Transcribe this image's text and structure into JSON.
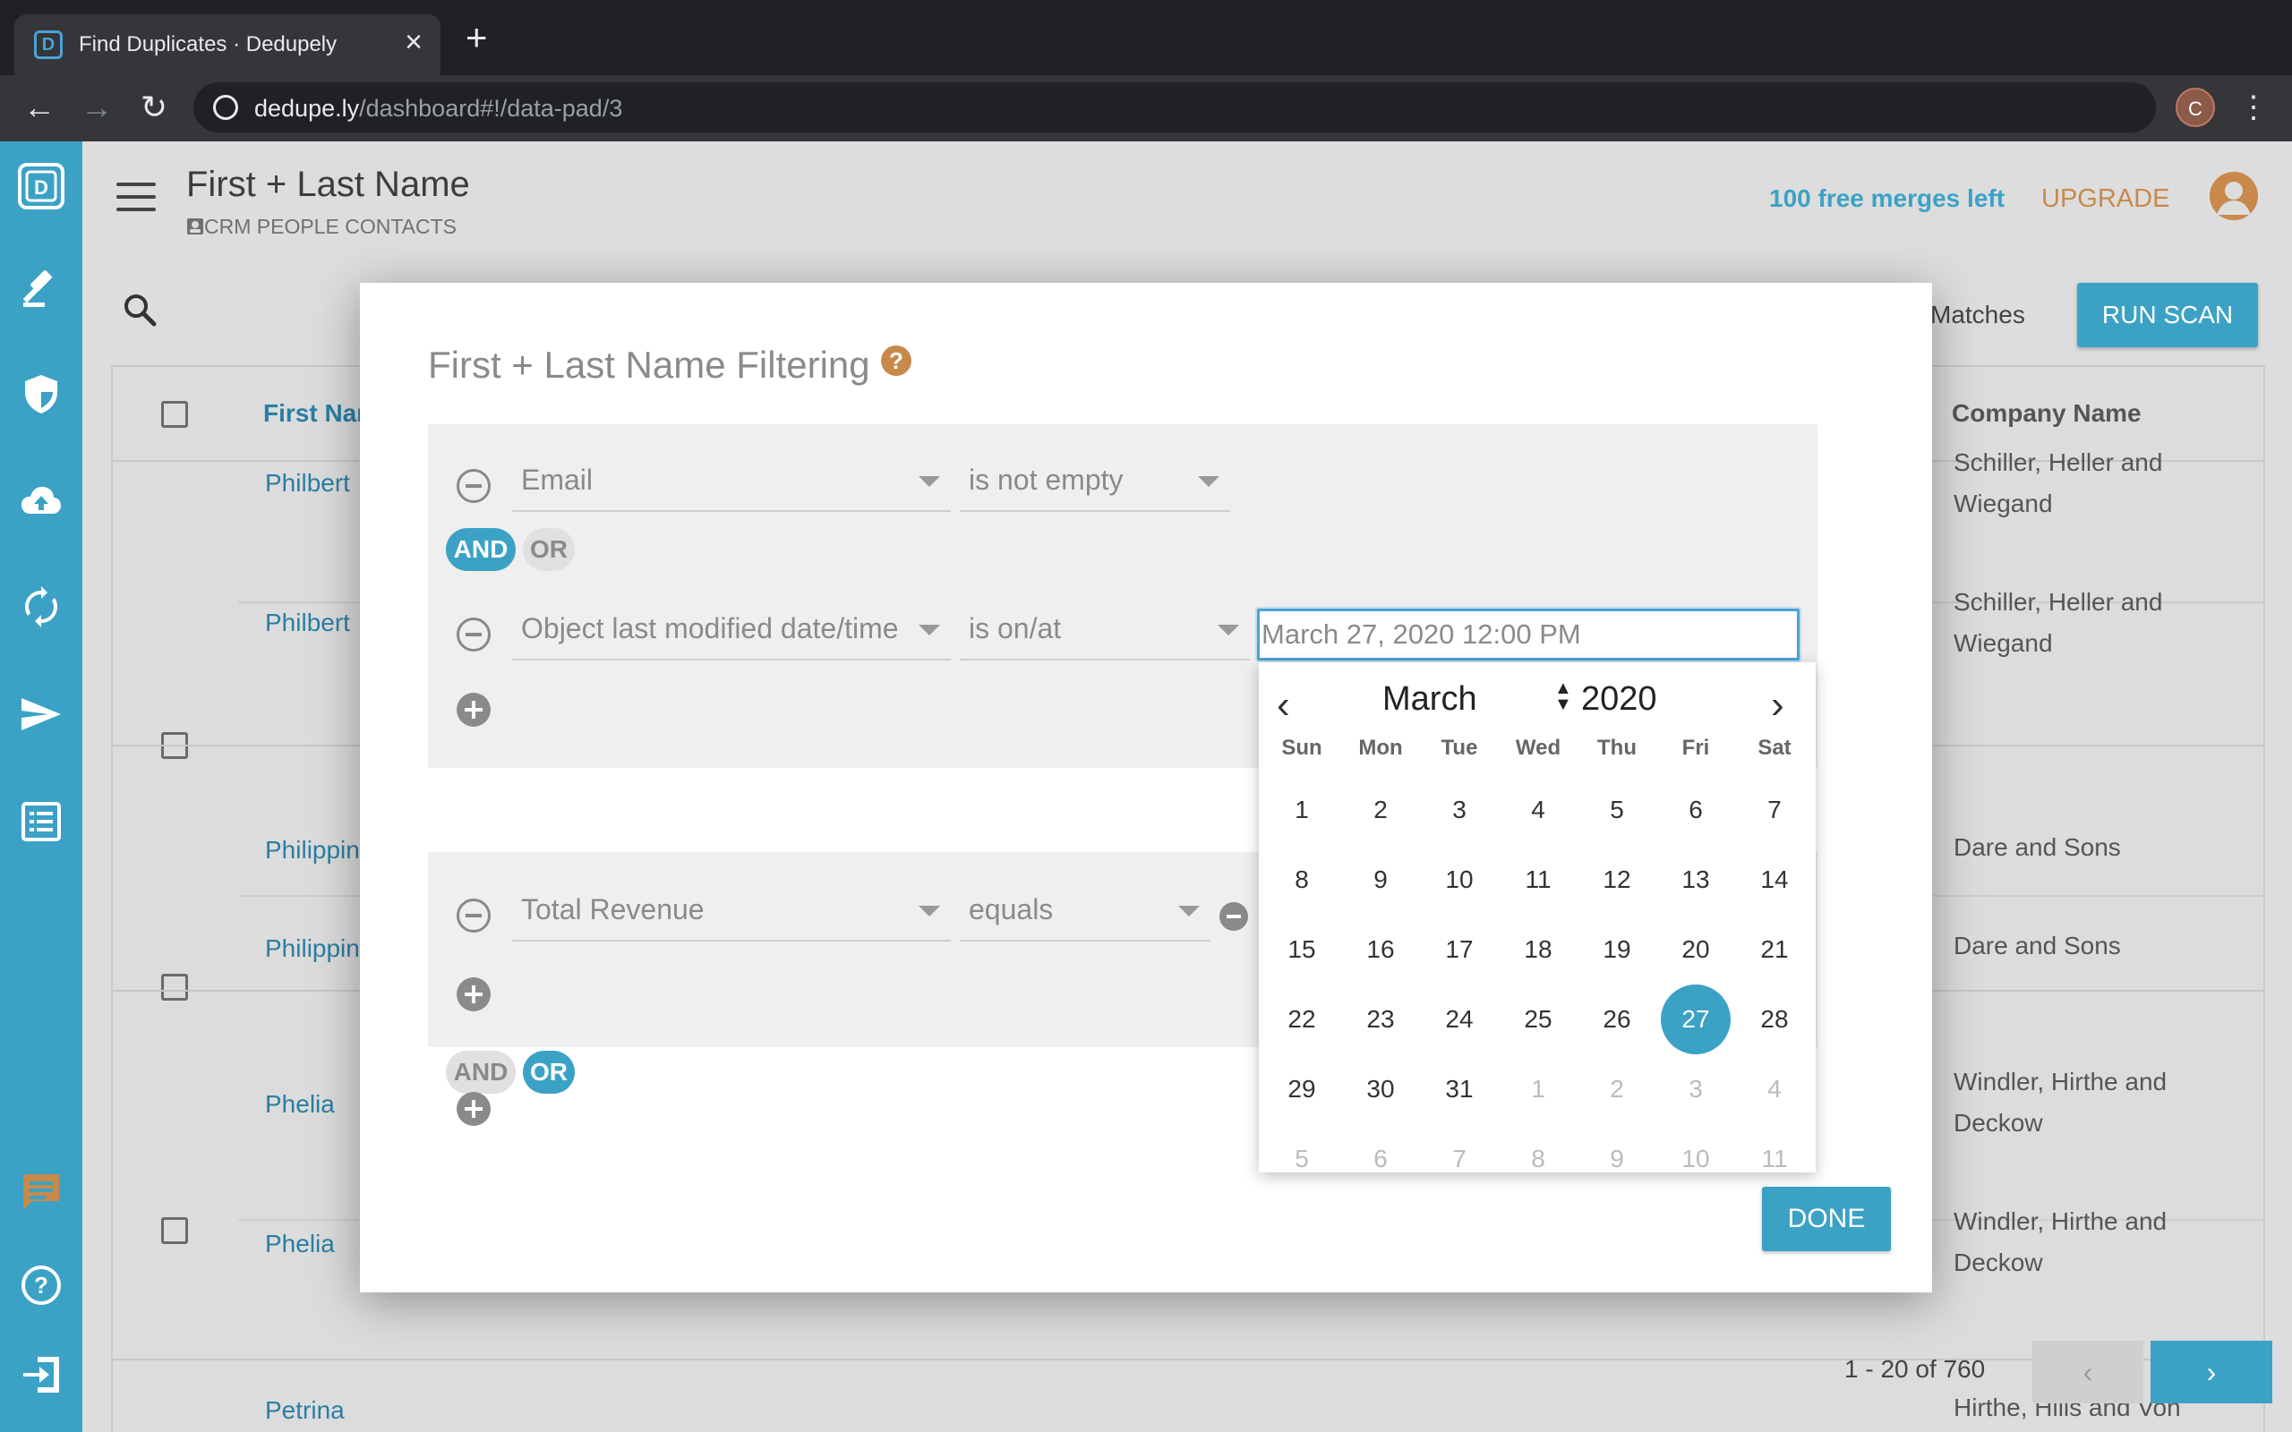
{
  "browser": {
    "tab_title": "Find Duplicates · Dedupely",
    "url_host": "dedupe.ly",
    "url_path": "/dashboard#!/data-pad/3",
    "profile_initial": "C"
  },
  "header": {
    "title": "First + Last Name",
    "subtitle": "CRM PEOPLE CONTACTS",
    "merges_left": "100 free merges left",
    "upgrade": "UPGRADE"
  },
  "toolbar": {
    "matches_label": "Matches",
    "run_scan": "RUN SCAN"
  },
  "table": {
    "col_first": "First Nar",
    "col_company": "Company Name",
    "rows": [
      {
        "first": "Philbert",
        "company": "Schiller, Heller and Wiegand"
      },
      {
        "first": "Philbert",
        "company": "Schiller, Heller and Wiegand"
      },
      {
        "first": "Philippin",
        "company": "Dare and Sons"
      },
      {
        "first": "Philippin",
        "company": "Dare and Sons"
      },
      {
        "first": "Phelia",
        "company": "Windler, Hirthe and Deckow"
      },
      {
        "first": "Phelia",
        "company": "Windler, Hirthe and Deckow"
      },
      {
        "first": "Petrina",
        "company": "Hirthe, Hills and Von"
      }
    ]
  },
  "pager": {
    "range": "1 - 20 of 760",
    "prev": "‹",
    "next": "›"
  },
  "modal": {
    "title": "First + Last Name Filtering",
    "help": "?",
    "group1": {
      "rule1_field": "Email",
      "rule1_op": "is not empty",
      "and": "AND",
      "or": "OR",
      "rule2_field": "Object last modified date/time",
      "rule2_op": "is on/at",
      "rule2_value": "March 27, 2020 12:00 PM"
    },
    "between": {
      "and": "AND",
      "or": "OR"
    },
    "group2": {
      "rule1_field": "Total Revenue",
      "rule1_op": "equals"
    },
    "done": "DONE"
  },
  "calendar": {
    "month": "March",
    "year": "2020",
    "weekdays": [
      "Sun",
      "Mon",
      "Tue",
      "Wed",
      "Thu",
      "Fri",
      "Sat"
    ],
    "days": [
      {
        "d": "1",
        "muted": false
      },
      {
        "d": "2",
        "muted": false
      },
      {
        "d": "3",
        "muted": false
      },
      {
        "d": "4",
        "muted": false
      },
      {
        "d": "5",
        "muted": false
      },
      {
        "d": "6",
        "muted": false
      },
      {
        "d": "7",
        "muted": false
      },
      {
        "d": "8",
        "muted": false
      },
      {
        "d": "9",
        "muted": false
      },
      {
        "d": "10",
        "muted": false
      },
      {
        "d": "11",
        "muted": false
      },
      {
        "d": "12",
        "muted": false
      },
      {
        "d": "13",
        "muted": false
      },
      {
        "d": "14",
        "muted": false
      },
      {
        "d": "15",
        "muted": false
      },
      {
        "d": "16",
        "muted": false
      },
      {
        "d": "17",
        "muted": false
      },
      {
        "d": "18",
        "muted": false
      },
      {
        "d": "19",
        "muted": false
      },
      {
        "d": "20",
        "muted": false
      },
      {
        "d": "21",
        "muted": false
      },
      {
        "d": "22",
        "muted": false
      },
      {
        "d": "23",
        "muted": false
      },
      {
        "d": "24",
        "muted": false
      },
      {
        "d": "25",
        "muted": false
      },
      {
        "d": "26",
        "muted": false
      },
      {
        "d": "27",
        "muted": false
      },
      {
        "d": "28",
        "muted": false
      },
      {
        "d": "29",
        "muted": false
      },
      {
        "d": "30",
        "muted": false
      },
      {
        "d": "31",
        "muted": false
      },
      {
        "d": "1",
        "muted": true
      },
      {
        "d": "2",
        "muted": true
      },
      {
        "d": "3",
        "muted": true
      },
      {
        "d": "4",
        "muted": true
      },
      {
        "d": "5",
        "muted": true
      },
      {
        "d": "6",
        "muted": true
      },
      {
        "d": "7",
        "muted": true
      },
      {
        "d": "8",
        "muted": true
      },
      {
        "d": "9",
        "muted": true
      },
      {
        "d": "10",
        "muted": true
      },
      {
        "d": "11",
        "muted": true
      }
    ],
    "selected": "27"
  },
  "colors": {
    "accent": "#3ba2c6",
    "upgrade": "#c8894a",
    "chrome": "#202124"
  }
}
